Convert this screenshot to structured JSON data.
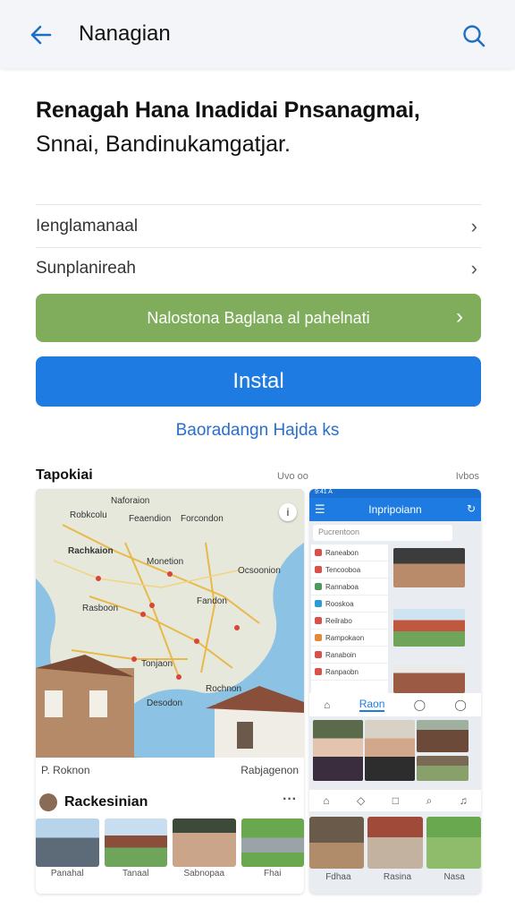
{
  "header": {
    "title": "Nanagian"
  },
  "headline": {
    "line1": "Renagah Hana Inadidai Pnsanagmai,",
    "line2": "Snnai, Bandinukamgatjar."
  },
  "rows": [
    {
      "label": "Ienglamanaal"
    },
    {
      "label": "Sunplanireah"
    }
  ],
  "buttons": {
    "green_label": "Nalostona Baglana al pahelnati",
    "install_label": "Instal"
  },
  "link": "Baoradangn Hajda ks",
  "section": {
    "label": "Tapokiai",
    "meta_left": "Uvo oo",
    "meta_right": "Ivbos"
  },
  "map": {
    "labels": [
      "Naforaion",
      "Robkcolu",
      "Feaendion",
      "Forcondon",
      "Rachkaion",
      "Monetion",
      "Ocsoonion",
      "Fandon",
      "Rasboon",
      "Tonjaon",
      "Rochnon",
      "Desodon"
    ]
  },
  "card1": {
    "caption_left": "P. Roknon",
    "caption_right": "Rabjagenon",
    "feed_title": "Rackesinian",
    "thumb_captions": [
      "Panahal",
      "Tanaal",
      "Sabnopaa",
      "Fhai"
    ]
  },
  "card2": {
    "status": "9:41 A",
    "app_title": "Inpripoiann",
    "search_placeholder": "Pucrentoon",
    "list": [
      "Raneabon",
      "Tencooboa",
      "Rannaboa",
      "Rooskoa",
      "Reilrabo",
      "Rampokaon",
      "Ranaboin",
      "Ranpaobn"
    ],
    "active_tab": "Raon",
    "captions": [
      "Fdhaa",
      "Rasina",
      "Nasa"
    ]
  },
  "colors": {
    "green": "#7fad5c",
    "blue": "#1e7be1",
    "link": "#2a6fc9"
  }
}
